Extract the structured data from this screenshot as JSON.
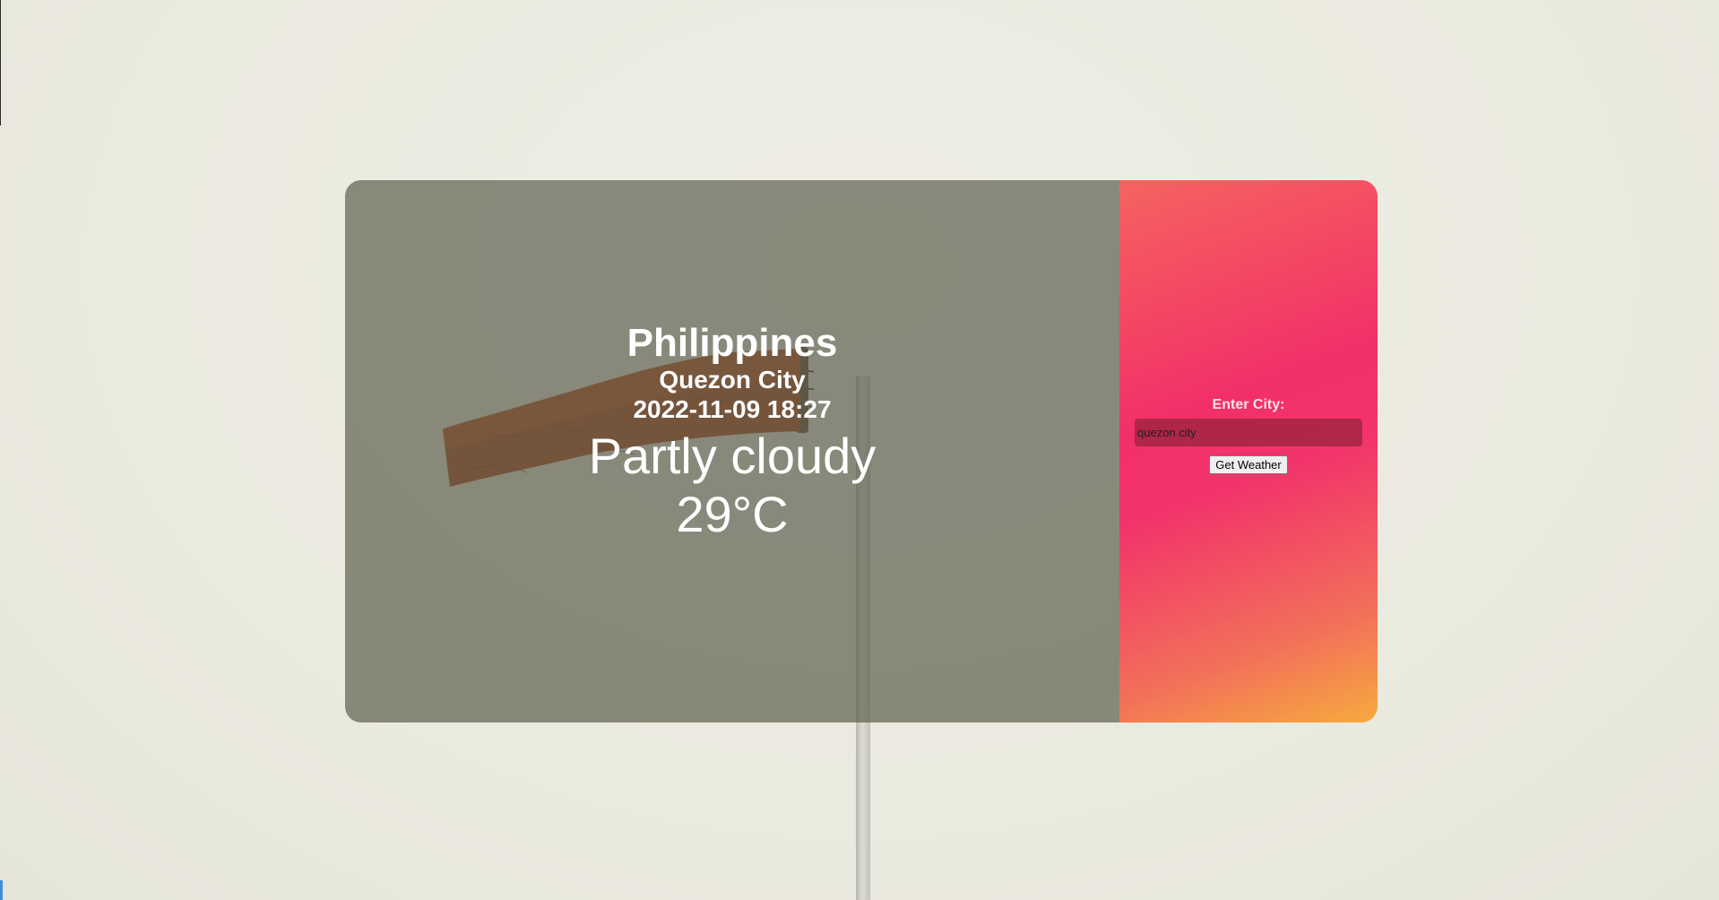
{
  "weather": {
    "country": "Philippines",
    "city": "Quezon City",
    "datetime": "2022-11-09 18:27",
    "condition": "Partly cloudy",
    "temperature": "29°C"
  },
  "search": {
    "label": "Enter City:",
    "input_value": "quezon city",
    "button_label": "Get Weather"
  },
  "colors": {
    "background": "#ecebe2",
    "overlay": "#85867a",
    "gradient_start": "#f5645f",
    "gradient_mid": "#f23068",
    "gradient_end": "#f7aa3e",
    "text": "#ffffff"
  },
  "icons": {
    "background_image": "windsock-photo"
  }
}
